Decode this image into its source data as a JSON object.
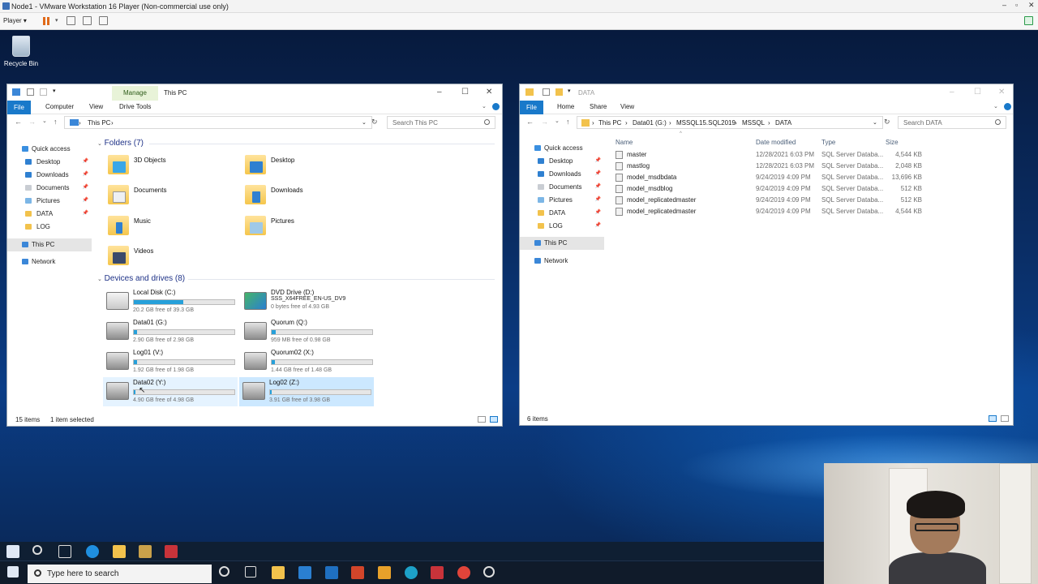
{
  "vmware": {
    "title": "Node1 - VMware Workstation 16 Player (Non-commercial use only)",
    "player_label": "Player"
  },
  "desktop": {
    "recycle_bin": "Recycle Bin"
  },
  "left_window": {
    "title": "This PC",
    "manage_tab": "Manage",
    "ribbon": [
      "File",
      "Computer",
      "View",
      "Drive Tools"
    ],
    "address": "This PC",
    "search_placeholder": "Search This PC",
    "nav": {
      "quick_access": "Quick access",
      "items": [
        "Desktop",
        "Downloads",
        "Documents",
        "Pictures",
        "DATA",
        "LOG"
      ],
      "this_pc": "This PC",
      "network": "Network"
    },
    "folders_header": "Folders (7)",
    "folders": [
      "3D Objects",
      "Desktop",
      "Documents",
      "Downloads",
      "Music",
      "Pictures",
      "Videos"
    ],
    "drives_header": "Devices and drives (8)",
    "drives": [
      {
        "name": "Local Disk (C:)",
        "free": "20.2 GB free of 39.3 GB",
        "used": 0.49
      },
      {
        "name": "DVD Drive (D:)",
        "sub": "SSS_X64FREE_EN-US_DV9",
        "free": "0 bytes free of 4.93 GB"
      },
      {
        "name": "Data01 (G:)",
        "free": "2.90 GB free of 2.98 GB",
        "used": 0.03
      },
      {
        "name": "Quorum (Q:)",
        "free": "959 MB free of 0.98 GB",
        "used": 0.04
      },
      {
        "name": "Log01 (V:)",
        "free": "1.92 GB free of 1.98 GB",
        "used": 0.03
      },
      {
        "name": "Quorum02 (X:)",
        "free": "1.44 GB free of 1.48 GB",
        "used": 0.03
      },
      {
        "name": "Data02 (Y:)",
        "free": "4.90 GB free of 4.98 GB",
        "used": 0.02
      },
      {
        "name": "Log02 (Z:)",
        "free": "3.91 GB free of 3.98 GB",
        "used": 0.02
      }
    ],
    "status_items": "15 items",
    "status_selected": "1 item selected"
  },
  "right_window": {
    "title": "DATA",
    "ribbon": [
      "File",
      "Home",
      "Share",
      "View"
    ],
    "breadcrumb": [
      "This PC",
      "Data01 (G:)",
      "MSSQL15.SQL2019",
      "MSSQL",
      "DATA"
    ],
    "search_placeholder": "Search DATA",
    "nav": {
      "quick_access": "Quick access",
      "items": [
        "Desktop",
        "Downloads",
        "Documents",
        "Pictures",
        "DATA",
        "LOG"
      ],
      "this_pc": "This PC",
      "network": "Network"
    },
    "columns": [
      "Name",
      "Date modified",
      "Type",
      "Size"
    ],
    "files": [
      {
        "name": "master",
        "date": "12/28/2021 6:03 PM",
        "type": "SQL Server Databa...",
        "size": "4,544 KB"
      },
      {
        "name": "mastlog",
        "date": "12/28/2021 6:03 PM",
        "type": "SQL Server Databa...",
        "size": "2,048 KB"
      },
      {
        "name": "model_msdbdata",
        "date": "9/24/2019 4:09 PM",
        "type": "SQL Server Databa...",
        "size": "13,696 KB"
      },
      {
        "name": "model_msdblog",
        "date": "9/24/2019 4:09 PM",
        "type": "SQL Server Databa...",
        "size": "512 KB"
      },
      {
        "name": "model_replicatedmaster",
        "date": "9/24/2019 4:09 PM",
        "type": "SQL Server Databa...",
        "size": "512 KB"
      },
      {
        "name": "model_replicatedmaster",
        "date": "9/24/2019 4:09 PM",
        "type": "SQL Server Databa...",
        "size": "4,544 KB"
      }
    ],
    "status_items": "6 items"
  },
  "taskbar": {
    "search_placeholder": "Type here to search"
  },
  "colors": {
    "accent": "#1979ca",
    "bar_fill": "#26a0da",
    "selection": "#cce8ff"
  }
}
